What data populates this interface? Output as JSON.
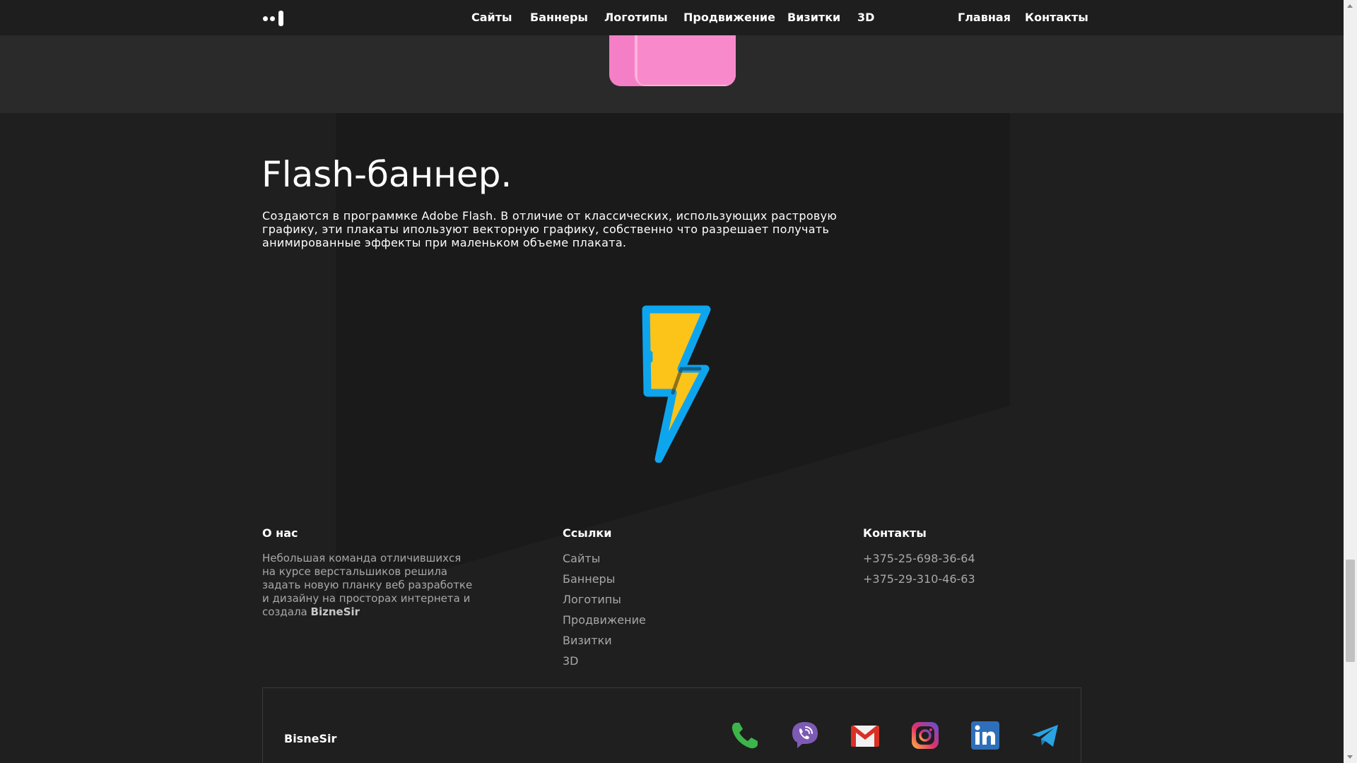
{
  "header": {
    "nav_left": [
      "Сайты",
      "Баннеры",
      "Логотипы",
      "Продвижение",
      "Визитки",
      "3D"
    ],
    "nav_right": [
      "Главная",
      "Контакты"
    ]
  },
  "content": {
    "title": "Flash-баннер.",
    "description": "Создаются в программке Adobe Flash. В отличие от классических, использующих растровую графику, эти плакаты ипользуют векторную графику, собственно что разрешает получать анимированные эффекты при маленьком объеме плаката."
  },
  "footer": {
    "about": {
      "heading": "О нас",
      "text": "Небольшая команда отличившихся на курсе верстальшиков решила задать новую планку веб разработке и дизайну на просторах интернета и создала",
      "brand": "BizneSir"
    },
    "links": {
      "heading": "Ссылки",
      "items": [
        "Сайты",
        "Баннеры",
        "Логотипы",
        "Продвижение",
        "Визитки",
        "3D"
      ]
    },
    "contacts": {
      "heading": "Контакты",
      "phones": [
        "+375-25-698-36-64",
        "+375-29-310-46-63"
      ]
    },
    "bottom": {
      "brand": "BisneSir",
      "social_icons": [
        "phone-icon",
        "viber-icon",
        "gmail-icon",
        "instagram-icon",
        "linkedin-icon",
        "telegram-icon"
      ]
    }
  },
  "colors": {
    "background": "#1f1f1f",
    "header": "#1e1e1e",
    "muted_text": "#a8a8a8",
    "bolt_blue": "#0ea5ef",
    "bolt_yellow": "#fcc419",
    "pink": "#f57fc6"
  },
  "scrollbar": {
    "position": 0.86
  }
}
